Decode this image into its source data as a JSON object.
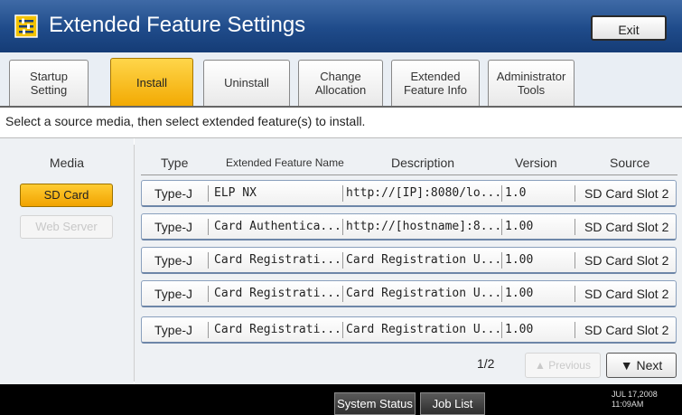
{
  "window": {
    "title": "Extended Feature Settings",
    "exit_label": "Exit"
  },
  "tabs": [
    {
      "label": "Startup\nSetting",
      "active": false
    },
    {
      "label": "Install",
      "active": true
    },
    {
      "label": "Uninstall",
      "active": false
    },
    {
      "label": "Change\nAllocation",
      "active": false
    },
    {
      "label": "Extended\nFeature Info",
      "active": false
    },
    {
      "label": "Administrator\nTools",
      "active": false
    }
  ],
  "instruction": "Select a source media, then select extended feature(s) to install.",
  "media": {
    "header": "Media",
    "options": [
      {
        "label": "SD Card",
        "state": "selected"
      },
      {
        "label": "Web Server",
        "state": "disabled"
      }
    ]
  },
  "table": {
    "columns": [
      "Type",
      "Extended Feature Name",
      "Description",
      "Version",
      "Source"
    ],
    "rows": [
      [
        "Type-J",
        "ELP NX",
        "http://[IP]:8080/lo...",
        "1.0",
        "SD Card Slot 2"
      ],
      [
        "Type-J",
        "Card Authentica...",
        "http://[hostname]:8...",
        "1.00",
        "SD Card Slot 2"
      ],
      [
        "Type-J",
        "Card Registrati...",
        "Card Registration U...",
        "1.00",
        "SD Card Slot 2"
      ],
      [
        "Type-J",
        "Card Registrati...",
        "Card Registration U...",
        "1.00",
        "SD Card Slot 2"
      ],
      [
        "Type-J",
        "Card Registrati...",
        "Card Registration U...",
        "1.00",
        "SD Card Slot 2"
      ]
    ]
  },
  "pagination": {
    "page": "1/2",
    "previous_label": "Previous",
    "next_label": "Next"
  },
  "bottom": {
    "system_status_label": "System Status",
    "job_list_label": "Job List",
    "date": "JUL  17,2008",
    "time": "11:09AM"
  },
  "colors": {
    "title_bar": "#1f4b8a",
    "accent": "#f4b000",
    "bottom_bar": "#000000"
  }
}
